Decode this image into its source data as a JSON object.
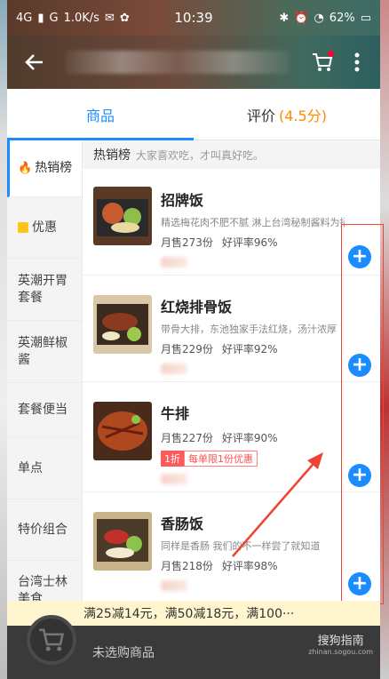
{
  "status": {
    "network": "4G",
    "signal": "G",
    "speed": "1.0K/s",
    "time": "10:39",
    "battery": "62%"
  },
  "tabs": {
    "goods": "商品",
    "reviews": "评价",
    "score": "(4.5分)"
  },
  "sidebar": {
    "items": [
      "热销榜",
      "优惠",
      "英潮开胃套餐",
      "英潮鲜椒酱",
      "套餐便当",
      "单点",
      "特价组合",
      "台湾士林美食"
    ]
  },
  "section": {
    "title": "热销榜",
    "subtitle": "大家喜欢吃，才叫真好吃。"
  },
  "items": [
    {
      "name": "招牌饭",
      "desc": "精选梅花肉不肥不腻 淋上台湾秘制酱料为招牌",
      "monthly": "月售273份",
      "rating": "好评率96%"
    },
    {
      "name": "红烧排骨饭",
      "desc": "带骨大排，东池独家手法红烧，汤汁浓厚",
      "monthly": "月售229份",
      "rating": "好评率92%"
    },
    {
      "name": "牛排",
      "desc": "",
      "monthly": "月售227份",
      "rating": "好评率90%",
      "promo_tag": "1折",
      "promo_text": "每单限1份优惠"
    },
    {
      "name": "香肠饭",
      "desc": "同样是香肠  我们的不一样尝了就知道",
      "monthly": "月售218份",
      "rating": "好评率98%"
    }
  ],
  "discount": "满25减14元，满50减18元，满100···",
  "cart": {
    "empty": "未选购商品"
  },
  "watermark": {
    "brand": "搜狗指南",
    "url": "zhinan.sogou.com"
  },
  "colors": {
    "accent": "#1a8cff",
    "promo": "#ff5a5a",
    "score": "#ff8a00"
  }
}
